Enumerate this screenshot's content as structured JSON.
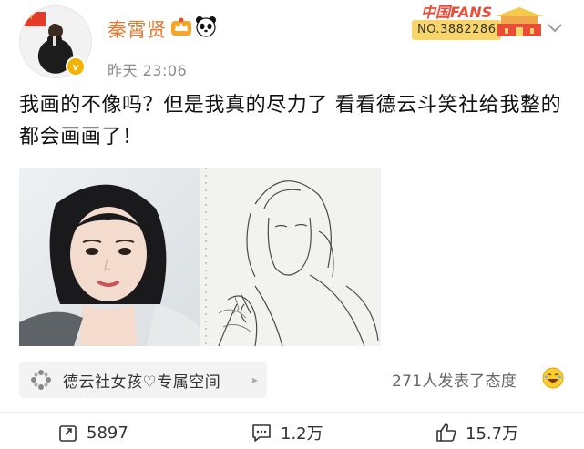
{
  "post": {
    "username": "秦霄贤",
    "timestamp": "昨天 23:06",
    "verified_symbol": "v",
    "fans_badge": {
      "title": "中国FANS",
      "number": "NO.3882286"
    },
    "text": "我画的不像吗？但是我真的尽力了  看看德云斗笑社给我整的都会画画了！",
    "tag": {
      "label": "德云社女孩♡专属空间",
      "arrow": "▸"
    },
    "reactions_text": "271人发表了态度",
    "actions": {
      "repost_count": "5897",
      "comment_count": "1.2万",
      "like_count": "15.7万"
    }
  },
  "icons": {
    "avatar": "avatar-image",
    "flag": "china-flag-icon",
    "verified": "verified-badge-icon",
    "crown": "crown-badge-icon",
    "panda": "panda-icon",
    "expand": "chevron-down-icon",
    "tag": "topic-dots-icon",
    "smile": "laugh-emoji-icon",
    "repost": "repost-icon",
    "comment": "comment-icon",
    "like": "thumbs-up-icon"
  },
  "colors": {
    "username": "#e87a2e",
    "verified": "#f3b100",
    "fans_red": "#e94d3a",
    "fans_gold": "#f7d56a"
  }
}
